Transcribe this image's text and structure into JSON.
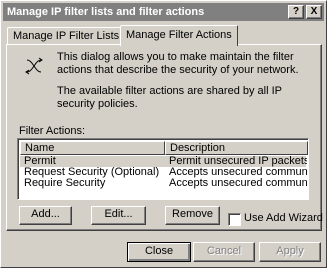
{
  "window": {
    "title": "Manage IP filter lists and filter actions",
    "help_button": "?",
    "close_button": "X"
  },
  "tabs": [
    {
      "label": "Manage IP Filter Lists",
      "active": false
    },
    {
      "label": "Manage Filter Actions",
      "active": true
    }
  ],
  "info": {
    "icon": "filter-action-icon",
    "paragraph1": "This dialog allows you to make maintain the filter actions that describe the security of your network.",
    "paragraph2": "The available filter actions are shared by all IP security policies."
  },
  "filter_actions": {
    "label": "Filter Actions:",
    "columns": [
      "Name",
      "Description"
    ],
    "rows": [
      {
        "name": "Permit",
        "description": "Permit unsecured IP packets to ...",
        "selected": true
      },
      {
        "name": "Request Security (Optional)",
        "description": "Accepts unsecured communicati..."
      },
      {
        "name": "Require Security",
        "description": "Accepts unsecured communicati..."
      }
    ]
  },
  "actions": {
    "add": "Add...",
    "edit": "Edit...",
    "remove": "Remove",
    "use_add_wizard": "Use Add Wizard",
    "use_add_wizard_checked": false
  },
  "footer": {
    "close": "Close",
    "cancel": "Cancel",
    "apply": "Apply"
  }
}
